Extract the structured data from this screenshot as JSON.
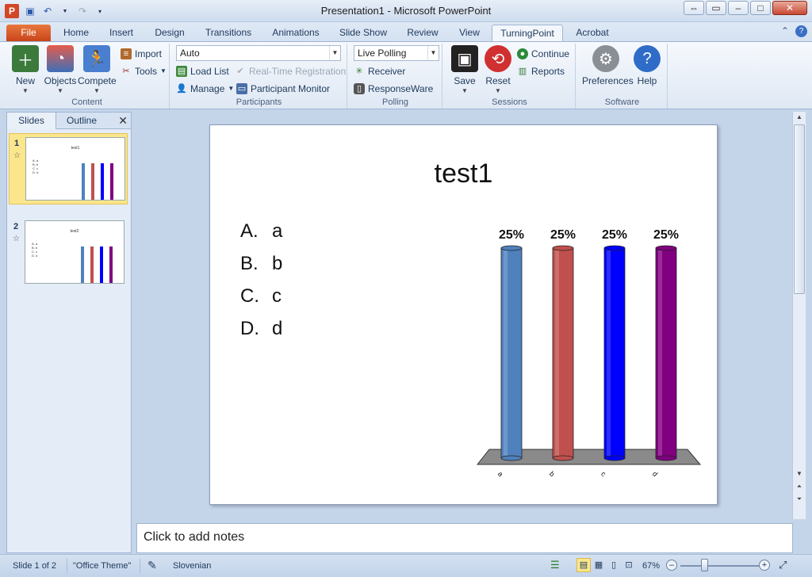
{
  "window": {
    "title": "Presentation1  -  Microsoft PowerPoint"
  },
  "tabs": [
    "File",
    "Home",
    "Insert",
    "Design",
    "Transitions",
    "Animations",
    "Slide Show",
    "Review",
    "View",
    "TurningPoint",
    "Acrobat"
  ],
  "active_tab": "TurningPoint",
  "ribbon": {
    "content": {
      "label": "Content",
      "new": "New",
      "objects": "Objects",
      "compete": "Compete",
      "import": "Import",
      "tools": "Tools"
    },
    "participants": {
      "label": "Participants",
      "combo_value": "Auto",
      "load_list": "Load List",
      "realtime": "Real-Time Registration",
      "manage": "Manage",
      "monitor": "Participant Monitor"
    },
    "polling": {
      "label": "Polling",
      "combo_value": "Live Polling",
      "receiver": "Receiver",
      "responseware": "ResponseWare"
    },
    "sessions": {
      "label": "Sessions",
      "save": "Save",
      "reset": "Reset",
      "continue": "Continue",
      "reports": "Reports"
    },
    "software": {
      "label": "Software",
      "preferences": "Preferences",
      "help": "Help"
    }
  },
  "panel": {
    "tab_slides": "Slides",
    "tab_outline": "Outline",
    "close": "✕",
    "thumbs": [
      {
        "num": "1",
        "title": "test1",
        "labels": [
          "A. a",
          "B. b",
          "C. c",
          "D. d"
        ]
      },
      {
        "num": "2",
        "title": "test2",
        "labels": [
          "A. a",
          "B. b",
          "C. c",
          "D. d"
        ]
      }
    ]
  },
  "slide": {
    "title": "test1",
    "answers": [
      {
        "letter": "A.",
        "text": "a"
      },
      {
        "letter": "B.",
        "text": "b"
      },
      {
        "letter": "C.",
        "text": "c"
      },
      {
        "letter": "D.",
        "text": "d"
      }
    ]
  },
  "chart_data": {
    "type": "bar",
    "categories": [
      "a",
      "b",
      "c",
      "d"
    ],
    "values": [
      25,
      25,
      25,
      25
    ],
    "data_labels": [
      "25%",
      "25%",
      "25%",
      "25%"
    ],
    "colors": [
      "#4f81bd",
      "#c0504d",
      "#0000ff",
      "#800080"
    ],
    "ylim": [
      0,
      25
    ]
  },
  "notes": {
    "placeholder": "Click to add notes"
  },
  "status": {
    "slide_info": "Slide 1 of 2",
    "theme": "\"Office Theme\"",
    "language": "Slovenian",
    "zoom": "67%"
  }
}
